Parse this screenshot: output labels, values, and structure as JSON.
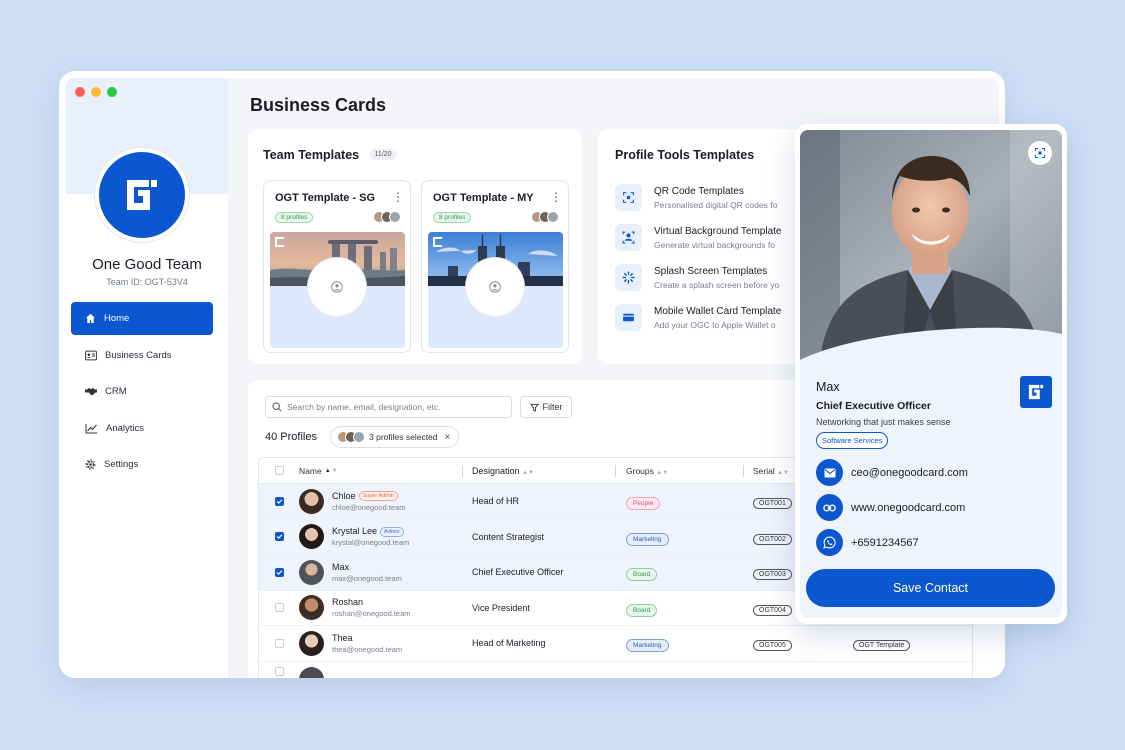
{
  "app": {
    "page_title": "Business Cards"
  },
  "sidebar": {
    "team_name": "One Good Team",
    "team_id": "Team ID: OGT-53V4",
    "items": [
      {
        "label": "Home",
        "icon": "home-icon",
        "active": true
      },
      {
        "label": "Business Cards",
        "icon": "id-card-icon",
        "active": false
      },
      {
        "label": "CRM",
        "icon": "handshake-icon",
        "active": false
      },
      {
        "label": "Analytics",
        "icon": "chart-line-icon",
        "active": false
      },
      {
        "label": "Settings",
        "icon": "gear-icon",
        "active": false
      }
    ]
  },
  "team_templates": {
    "title": "Team Templates",
    "count": "11/20",
    "templates": [
      {
        "name": "OGT Template - SG",
        "profiles": "8 profiles"
      },
      {
        "name": "OGT Template - MY",
        "profiles": "8 profiles"
      }
    ]
  },
  "profile_tools": {
    "title": "Profile Tools Templates",
    "items": [
      {
        "title": "QR Code Templates",
        "desc": "Personalised digital QR codes fo",
        "icon": "qr-code-icon"
      },
      {
        "title": "Virtual Background Template",
        "desc": "Generate virtual backgrounds fo",
        "icon": "virtual-background-icon"
      },
      {
        "title": "Splash Screen Templates",
        "desc": "Create a splash screen before yo",
        "icon": "loading-spinner-icon"
      },
      {
        "title": "Mobile Wallet Card Template",
        "desc": "Add your OGC to Apple Wallet o",
        "icon": "wallet-icon"
      }
    ]
  },
  "profiles": {
    "search_placeholder": "Search by name, email, designation, etc.",
    "filter_label": "Filter",
    "count_label": "40 Profiles",
    "selected_label": "3 profiles selected",
    "clear_icon": "×",
    "columns": {
      "name": "Name",
      "designation": "Designation",
      "groups": "Groups",
      "serial": "Serial"
    },
    "rows": [
      {
        "name": "Chloe",
        "email": "chloe@onegood.team",
        "role": "Super Admin",
        "designation": "Head of HR",
        "group": "People",
        "serial": "OGT001",
        "template": "",
        "selected": true
      },
      {
        "name": "Krystal Lee",
        "email": "krystal@onegood.team",
        "role": "Admin",
        "designation": "Content Strategist",
        "group": "Marketing",
        "serial": "OGT002",
        "template": "",
        "selected": true
      },
      {
        "name": "Max",
        "email": "max@onegood.team",
        "role": "",
        "designation": "Chief Executive Officer",
        "group": "Board",
        "serial": "OGT003",
        "template": "",
        "selected": true
      },
      {
        "name": "Roshan",
        "email": "roshan@onegood.team",
        "role": "",
        "designation": "Vice President",
        "group": "Board",
        "serial": "OGT004",
        "template": "",
        "selected": false
      },
      {
        "name": "Thea",
        "email": "thea@onegood.team",
        "role": "",
        "designation": "Head of Marketing",
        "group": "Marketing",
        "serial": "OGT005",
        "template": "OGT Template",
        "selected": false
      }
    ]
  },
  "profile_card": {
    "name": "Max",
    "title": "Chief Executive Officer",
    "tagline": "Networking that just makes sense",
    "industry": "Software Services",
    "email": "ceo@onegoodcard.com",
    "website": "www.onegoodcard.com",
    "phone": "+6591234567",
    "save_label": "Save Contact"
  },
  "colors": {
    "brand": "#0b57d0",
    "background": "#cddff5"
  }
}
